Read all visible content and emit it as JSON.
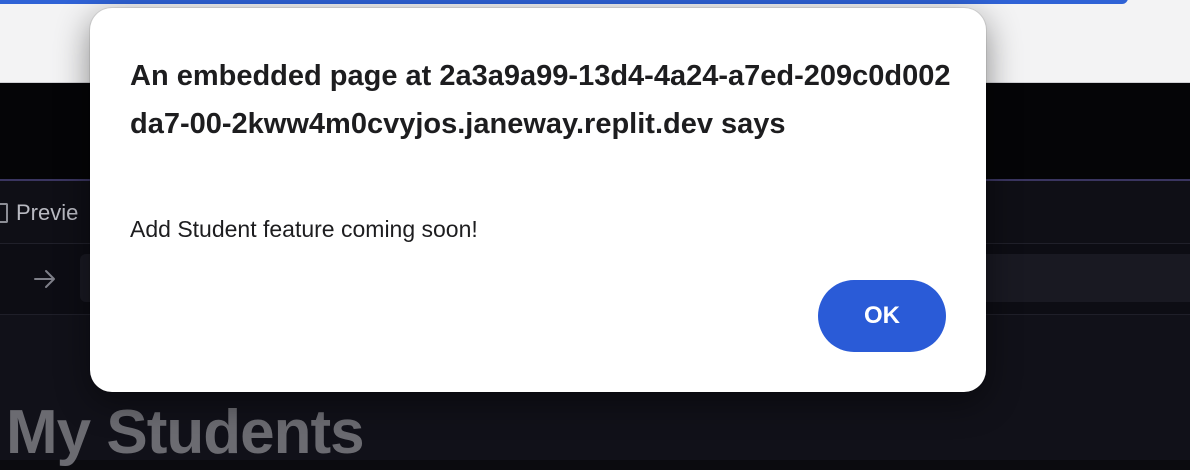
{
  "alert": {
    "title": "An embedded page at 2a3a9a99-13d4-4a24-a7ed-209c0d002da7-00-2kww4m0cvyjos.janeway.replit.dev says",
    "message": "Add Student feature coming soon!",
    "ok_label": "OK"
  },
  "workspace": {
    "tab_label": "Previe",
    "page_heading": "My Students"
  },
  "icons": {
    "tab": "preview-tab-icon",
    "forward": "forward-arrow-icon"
  },
  "colors": {
    "accent": "#2a5bd7",
    "dialog_bg": "#ffffff",
    "workspace_bg": "#0b0b0f"
  }
}
